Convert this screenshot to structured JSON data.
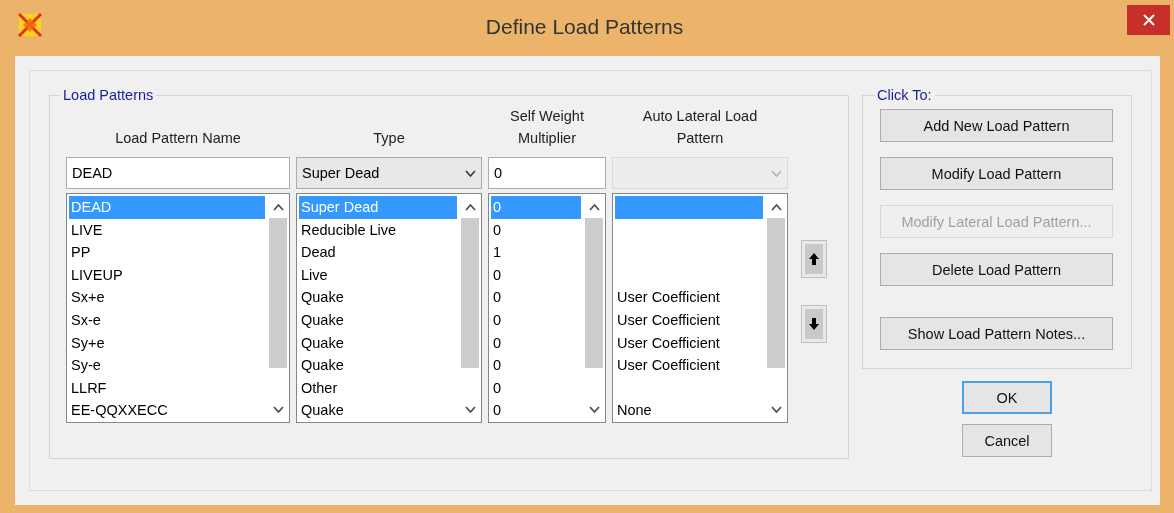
{
  "window": {
    "title": "Define Load Patterns"
  },
  "load_patterns": {
    "label": "Load Patterns",
    "columns": [
      {
        "header": "Load Pattern Name"
      },
      {
        "header": "Type"
      },
      {
        "header": "Self Weight Multiplier"
      },
      {
        "header": "Auto Lateral Load Pattern"
      }
    ],
    "name_field": {
      "value": "DEAD"
    },
    "type_dropdown": {
      "value": "Super Dead",
      "disabled": false
    },
    "multiplier_field": {
      "value": "0"
    },
    "auto_lateral_dropdown": {
      "disabled": true
    },
    "rows": [
      {
        "name": "DEAD",
        "type": "Super Dead",
        "multiplier": "0",
        "selected": true
      },
      {
        "name": "LIVE",
        "type": "Reducible Live",
        "multiplier": "0",
        "selected": false
      },
      {
        "name": "PP",
        "type": "Dead",
        "multiplier": "1",
        "selected": false
      },
      {
        "name": "LIVEUP",
        "type": "Live",
        "multiplier": "0",
        "selected": false
      },
      {
        "name": "Sx+e",
        "type": "Quake",
        "multiplier": "0",
        "auto_lateral": "User Coefficient",
        "selected": false
      },
      {
        "name": "Sx-e",
        "type": "Quake",
        "multiplier": "0",
        "auto_lateral": "User Coefficient",
        "selected": false
      },
      {
        "name": "Sy+e",
        "type": "Quake",
        "multiplier": "0",
        "auto_lateral": "User Coefficient",
        "selected": false
      },
      {
        "name": "Sy-e",
        "type": "Quake",
        "multiplier": "0",
        "auto_lateral": "User Coefficient",
        "selected": false
      },
      {
        "name": "LLRF",
        "type": "Other",
        "multiplier": "0",
        "selected": false
      },
      {
        "name": "EE-QQXXECC",
        "type": "Quake",
        "multiplier": "0",
        "auto_lateral": "None",
        "selected": false
      }
    ]
  },
  "click_to": {
    "label": "Click To:",
    "buttons": [
      {
        "label": "Add New Load Pattern",
        "disabled": false
      },
      {
        "label": "Modify Load Pattern",
        "disabled": false
      },
      {
        "label": "Modify Lateral Load Pattern...",
        "disabled": true
      },
      {
        "label": "Delete Load Pattern",
        "disabled": false
      },
      {
        "label": "Show Load Pattern Notes...",
        "disabled": false
      }
    ]
  },
  "dialog_buttons": [
    {
      "label": "OK",
      "default": true
    },
    {
      "label": "Cancel",
      "default": false
    }
  ]
}
